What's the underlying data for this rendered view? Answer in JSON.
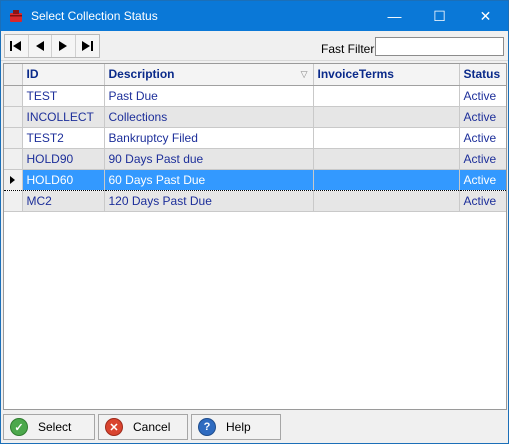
{
  "window": {
    "title": "Select Collection Status",
    "minimize_glyph": "—",
    "maximize_glyph": "☐",
    "close_glyph": "✕",
    "accent": "#0a78d7"
  },
  "toolbar": {
    "nav_icons": [
      "first-record-icon",
      "previous-record-icon",
      "next-record-icon",
      "last-record-icon"
    ],
    "fast_filter_label": "Fast Filter",
    "fast_filter_value": ""
  },
  "grid": {
    "columns": [
      "ID",
      "Description",
      "InvoiceTerms",
      "Status"
    ],
    "sort_glyph": "▽",
    "rows": [
      {
        "id": "TEST",
        "description": "Past Due",
        "invoice_terms": "",
        "status": "Active"
      },
      {
        "id": "INCOLLECT",
        "description": "Collections",
        "invoice_terms": "",
        "status": "Active"
      },
      {
        "id": "TEST2",
        "description": "Bankruptcy Filed",
        "invoice_terms": "",
        "status": "Active"
      },
      {
        "id": "HOLD90",
        "description": "90 Days Past due",
        "invoice_terms": "",
        "status": "Active"
      },
      {
        "id": "HOLD60",
        "description": "60 Days Past Due",
        "invoice_terms": "",
        "status": "Active"
      },
      {
        "id": "MC2",
        "description": "120 Days Past Due",
        "invoice_terms": "",
        "status": "Active"
      }
    ],
    "selected_row_color": "#3399ff"
  },
  "footer": {
    "select_label": "Select",
    "cancel_label": "Cancel",
    "help_label": "Help"
  }
}
